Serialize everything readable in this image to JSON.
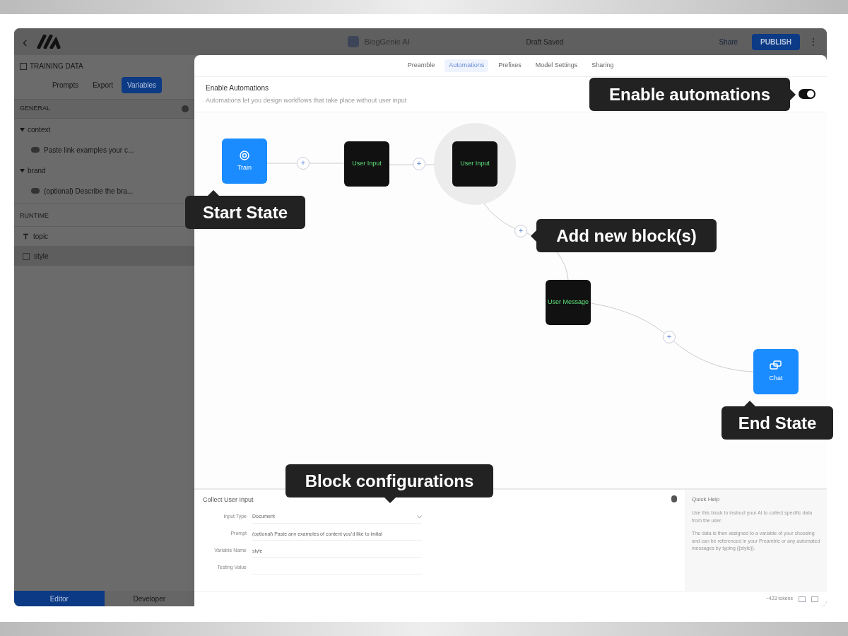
{
  "header": {
    "app_name": "BlogGenie AI",
    "save_status": "Draft Saved",
    "share_label": "Share",
    "publish_label": "PUBLISH",
    "menu_glyph": "⋮",
    "back_glyph": "‹"
  },
  "sidebar": {
    "title": "TRAINING DATA",
    "tabs": [
      {
        "label": "Prompts",
        "selected": false
      },
      {
        "label": "Export",
        "selected": false
      },
      {
        "label": "Variables",
        "selected": true
      }
    ],
    "general_heading": "GENERAL",
    "tree": [
      {
        "label": "context",
        "expanded": true,
        "children": [
          {
            "label": "Paste link examples your c..."
          }
        ]
      },
      {
        "label": "brand",
        "expanded": true,
        "children": [
          {
            "label": "(optional) Describe the bra..."
          }
        ]
      }
    ],
    "runtime_heading": "RUNTIME",
    "runtime_items": [
      {
        "label": "topic",
        "kind": "text",
        "selected": false
      },
      {
        "label": "style",
        "kind": "file",
        "selected": true
      }
    ],
    "footer_tabs": [
      {
        "label": "Editor",
        "selected": true
      },
      {
        "label": "Developer",
        "selected": false
      }
    ]
  },
  "modal": {
    "tabs": [
      {
        "label": "Preamble",
        "selected": false
      },
      {
        "label": "Automations",
        "selected": true
      },
      {
        "label": "Prefixes",
        "selected": false
      },
      {
        "label": "Model Settings",
        "selected": false
      },
      {
        "label": "Sharing",
        "selected": false
      }
    ],
    "enable_title": "Enable Automations",
    "enable_description": "Automations let you design workflows that take place without user input",
    "enable_on": true,
    "nodes": [
      {
        "label": "Train",
        "kind": "start",
        "highlighted": false
      },
      {
        "label": "User Input",
        "kind": "step",
        "highlighted": false
      },
      {
        "label": "User Input",
        "kind": "step",
        "highlighted": true
      },
      {
        "label": "User Message",
        "kind": "step",
        "highlighted": false
      },
      {
        "label": "Chat",
        "kind": "end",
        "highlighted": false
      }
    ],
    "add_glyph": "+",
    "config": {
      "title": "Collect User Input",
      "fields": [
        {
          "label": "Input Type",
          "kind": "select",
          "value": "Document"
        },
        {
          "label": "Prompt",
          "kind": "text",
          "value": "(optional) Paste any examples of content you'd like to imital"
        },
        {
          "label": "Variable Name",
          "kind": "text",
          "value": "style"
        },
        {
          "label": "Testing Value",
          "kind": "text"
        }
      ]
    },
    "help": {
      "title": "Quick Help",
      "paragraphs": [
        "Use this block to instruct your AI to collect specific data from the user.",
        "The data is then assigned to a variable of your choosing and can be referenced in your Preamble or any automated messages by typing {{style}}."
      ]
    },
    "tokens": "~423 tokens"
  },
  "callouts": [
    {
      "text": "Enable automations"
    },
    {
      "text": "Start State"
    },
    {
      "text": "Add new block(s)"
    },
    {
      "text": "End State"
    },
    {
      "text": "Block configurations"
    }
  ]
}
